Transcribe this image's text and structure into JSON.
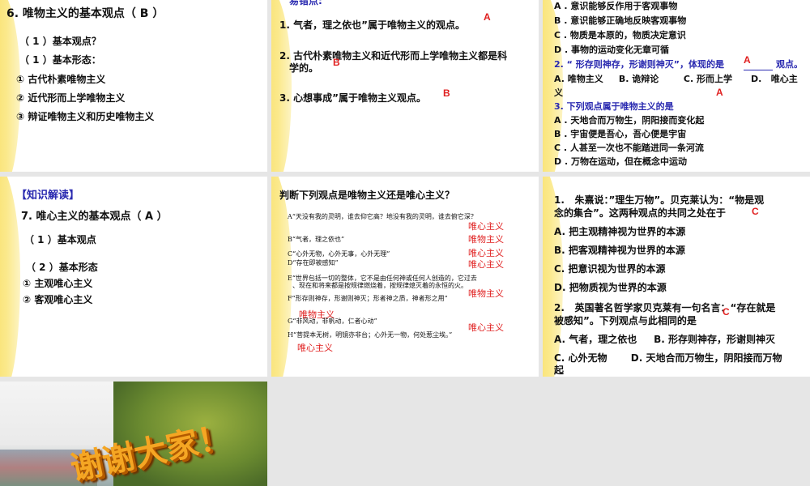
{
  "slide1": {
    "title": "6. 唯物主义的基本观点（ B ）",
    "lines": [
      "（ 1 ）基本观点？",
      "（ 1 ）基本形态：",
      "① 古代朴素唯物主义",
      "② 近代形而上学唯物主义",
      "③ 辩证唯物主义和历史唯物主义"
    ]
  },
  "slide2": {
    "header": "易错点:",
    "q1": "1.  气者，理之依也”属于唯物主义的观点。",
    "a1": "A",
    "q2a": "2.  古代朴素唯物主义和近代形而上学唯物主义都是科",
    "q2b": "学的。",
    "a2": "B",
    "q3": "3.    心想事成”属于唯物主义观点。",
    "a3": "B"
  },
  "slide3": {
    "lines": [
      "A . 意识能够反作用于客观事物",
      "B . 意识能够正确地反映客观事物",
      "C . 物质是本原的，物质决定意识",
      "D . 事物的运动变化无章可循"
    ],
    "q2": "2. “ 形存则神存，形谢则神灭”，体现的是",
    "q2end": "观点。",
    "q2ans": "A",
    "opts": "A. 唯物主义     B. 诡辩论        C. 形而上学      D.   唯心主",
    "opts2": "义",
    "ans2": "A",
    "q3": "3. 下列观点属于唯物主义的是",
    "lines3": [
      "A . 天地合而万物生，阴阳接而变化起",
      "B . 宇宙便是吾心，吾心便是宇宙",
      "C . 人甚至一次也不能踏进同一条河流",
      "D . 万物在运动，但在概念中运动"
    ]
  },
  "slide4": {
    "header": "【知识解读】",
    "title": "7. 唯心主义的基本观点（ A ）",
    "lines": [
      "（ 1 ）基本观点",
      "（ 2 ）基本形态",
      "① 主观唯心主义",
      "② 客观唯心主义"
    ]
  },
  "slide5": {
    "title": "判断下列观点是唯物主义还是唯心主义？",
    "items": [
      {
        "q": "A“天没有我的灵明，谁去仰它高？地没有我的灵明，谁去俯它深？",
        "a": "唯心主义"
      },
      {
        "q": "B“气者，理之依也”",
        "a": "唯物主义"
      },
      {
        "q": "C“心外无物，心外无事，心外无理”",
        "a": "唯心主义"
      },
      {
        "q": "D“存在即被感知”",
        "a": "唯心主义"
      },
      {
        "q": "E“世界包括一切的整体，它不是由任何神或任何人创造的，它过去",
        "q2": "、现在和将来都是按规律燃烧着，按规律熄灭着的永恒的火。",
        "a": "唯物主义"
      },
      {
        "q": "F“形存则神存，形谢则神灭；形者神之质，神者形之用”",
        "a": "唯物主义"
      },
      {
        "q": "G“非风动，非帆动，仁者心动”",
        "a": "唯心主义"
      },
      {
        "q": "H“菩提本无树，明镜亦非台；心外无一物，何处惹尘埃。”",
        "a": "唯心主义"
      }
    ]
  },
  "slide6": {
    "q1a": "1.   朱熹说：”理生万物”。贝克莱认为：“物是观",
    "q1b": "念的集合”。这两种观点的共同之处在于",
    "a1": "C",
    "opts1": [
      "A. 把主观精神视为世界的本源",
      "B. 把客观精神视为世界的本源",
      "C. 把意识视为世界的本源",
      "D. 把物质视为世界的本源"
    ],
    "q2a": "2.   英国著名哲学家贝克莱有一句名言：“存在就是",
    "q2b": "被感知”。下列观点与此相同的是",
    "a2": "C",
    "o1": "A. 气者，理之依也     B. 形存则神存，形谢则神灭",
    "o2": "C. 心外无物       D. 天地合而万物生，阴阳接而万物",
    "o3": "起"
  },
  "slide7": {
    "text": "谢谢大家！"
  }
}
